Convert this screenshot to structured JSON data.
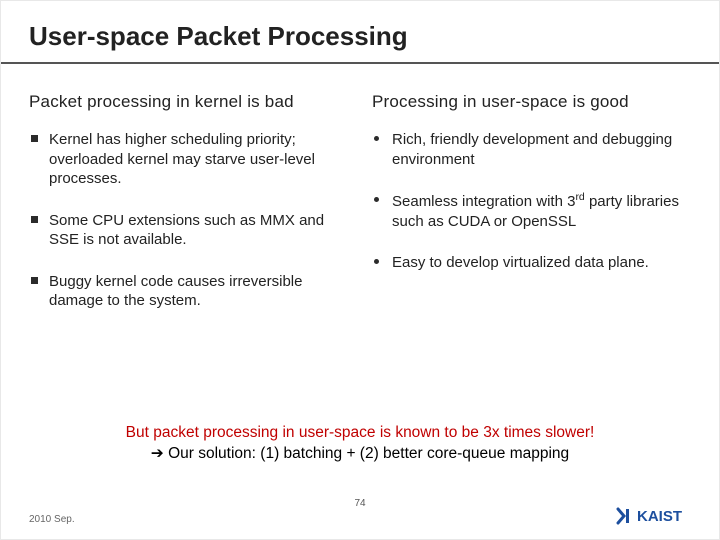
{
  "title": "User-space Packet Processing",
  "left": {
    "heading": "Packet processing in kernel is bad",
    "items": [
      "Kernel has higher scheduling priority; overloaded kernel may starve user-level processes.",
      "Some CPU extensions such as MMX and SSE is not available.",
      "Buggy kernel code causes irreversible damage to the system."
    ]
  },
  "right": {
    "heading": "Processing in user-space is good",
    "items": [
      {
        "pre": "Rich, friendly development and debugging environment"
      },
      {
        "pre": "Seamless integration with 3",
        "sup": "rd",
        "post": " party libraries such as CUDA or OpenSSL"
      },
      {
        "pre": "Easy to develop virtualized data plane."
      }
    ]
  },
  "summary": {
    "line1": "But packet processing in user-space is known to be 3x times slower!",
    "arrow": "➔",
    "line2": " Our solution: (1) batching + (2) better core-queue mapping"
  },
  "footer": {
    "date": "2010 Sep.",
    "page": "74",
    "logo_text": "KAIST"
  }
}
